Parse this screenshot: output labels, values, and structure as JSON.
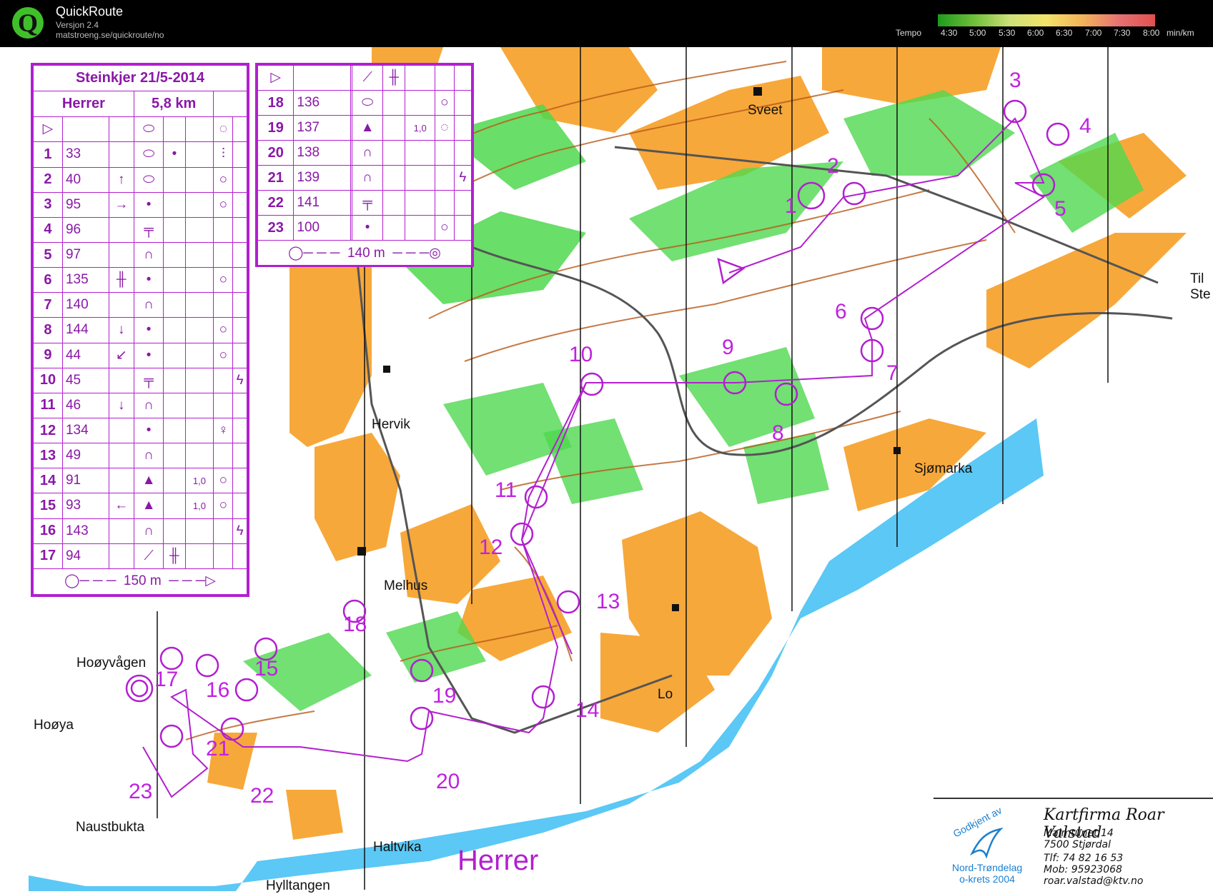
{
  "app": {
    "title": "QuickRoute",
    "version": "Versjon 2.4",
    "url": "matstroeng.se/quickroute/no",
    "tempo_label": "Tempo",
    "tempo_ticks": [
      "4:30",
      "5:00",
      "5:30",
      "6:00",
      "6:30",
      "7:00",
      "7:30",
      "8:00",
      "min/km"
    ]
  },
  "event": {
    "title": "Steinkjer 21/5-2014",
    "class": "Herrer",
    "length": "5,8 km",
    "course_label": "Herrer"
  },
  "desc1": {
    "rows": [
      {
        "num": "1",
        "code": "33"
      },
      {
        "num": "2",
        "code": "40"
      },
      {
        "num": "3",
        "code": "95"
      },
      {
        "num": "4",
        "code": "96"
      },
      {
        "num": "5",
        "code": "97"
      },
      {
        "num": "6",
        "code": "135"
      },
      {
        "num": "7",
        "code": "140"
      },
      {
        "num": "8",
        "code": "144"
      },
      {
        "num": "9",
        "code": "44"
      },
      {
        "num": "10",
        "code": "45"
      },
      {
        "num": "11",
        "code": "46"
      },
      {
        "num": "12",
        "code": "134"
      },
      {
        "num": "13",
        "code": "49"
      },
      {
        "num": "14",
        "code": "91",
        "size": "1,0"
      },
      {
        "num": "15",
        "code": "93",
        "size": "1,0"
      },
      {
        "num": "16",
        "code": "143"
      },
      {
        "num": "17",
        "code": "94"
      }
    ],
    "footer": "150 m"
  },
  "desc2": {
    "rows": [
      {
        "num": "18",
        "code": "136"
      },
      {
        "num": "19",
        "code": "137",
        "size": "1,0"
      },
      {
        "num": "20",
        "code": "138"
      },
      {
        "num": "21",
        "code": "139"
      },
      {
        "num": "22",
        "code": "141"
      },
      {
        "num": "23",
        "code": "100"
      }
    ],
    "footer": "140 m"
  },
  "places": [
    "Sveet",
    "Til",
    "Ste",
    "Hervik",
    "Sjømarka",
    "Melhus",
    "Hoøyvågen",
    "Hoøya",
    "Lo",
    "Naustbukta",
    "Haltvika",
    "Hylltangen"
  ],
  "controls": [
    "1",
    "2",
    "3",
    "4",
    "5",
    "6",
    "7",
    "8",
    "9",
    "10",
    "11",
    "12",
    "13",
    "14",
    "15",
    "16",
    "17",
    "18",
    "19",
    "20",
    "21",
    "22",
    "23"
  ],
  "mapmaker": {
    "firm": "Kartfirma Roar Valstad",
    "address": "Malmtunet 14",
    "city": "7500 Stjørdal",
    "phone": "Tlf:  74 82 16 53",
    "mobile": "Mob: 95923068",
    "email": "roar.valstad@ktv.no",
    "approved": "Godkjent av",
    "org1": "Nord-Trøndelag",
    "org2": "o-krets 2004"
  },
  "colors": {
    "course": "#b21fcf",
    "forest": "#ffffff",
    "open": "#f7a83a",
    "green": "#4fd84f",
    "water": "#5bc8f5",
    "contour": "#b85a1a"
  }
}
